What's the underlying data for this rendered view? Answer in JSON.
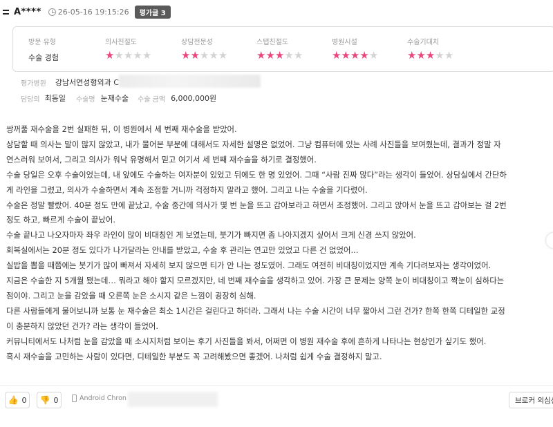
{
  "header": {
    "user_name": "A****",
    "timestamp": "26-05-16 19:15:26",
    "rating_badge": "평가글 3"
  },
  "ratings": {
    "visit_type": {
      "label": "방문 유형",
      "value": "수술 경험"
    },
    "items": [
      {
        "label": "의사친절도",
        "stars": 1,
        "max": 5
      },
      {
        "label": "상담전문성",
        "stars": 2,
        "max": 5
      },
      {
        "label": "스탭친절도",
        "stars": 3,
        "max": 5
      },
      {
        "label": "병원시설",
        "stars": 4,
        "max": 5
      },
      {
        "label": "수술기대치",
        "stars": 3,
        "max": 5
      }
    ],
    "star_on_color": "#e8467c",
    "star_off_color": "#d3d3d3"
  },
  "meta": {
    "hospital_label": "평가병원",
    "hospital_value": "강남서연성형외과 C",
    "doctor_label": "담당의",
    "doctor_value": "최동일",
    "surgery_label": "수술명",
    "surgery_value": "눈재수술",
    "price_label": "수술 금액",
    "price_value": "6,000,000원"
  },
  "review": {
    "lines": [
      "쌍꺼풀 재수술을 2번 실패한 뒤, 이 병원에서 세 번째 재수술을 받았어.",
      "상담할 때 의사는 말이 많지 않았고, 내가 물어본 부분에 대해서도 자세한 설명은 없었어. 그냥 컴퓨터에 있는 사례 사진들을 보여줬는데, 결과가 정말 자",
      "연스러워 보여서, 그리고 의사가 워낙 유명해서 믿고 여기서 세 번째 재수술을 하기로 결정했어.",
      "수술 당일은 오후 수술이었는데, 내 앞에도 수술하는 여자분이 있었고 뒤에도 한 명 있었어. 그때 “사람 진짜 많다”라는 생각이 들었어. 상담실에서 간단하",
      "게 라인을 그렸고, 의사가 수술하면서 계속 조정할 거니까 걱정하지 말라고 했어. 그리고 나는 수술을 기다렸어.",
      "수술은 정말 빨랐어. 40분 정도 만에 끝났고, 수술 중간에 의사가 몇 번 눈을 뜨고 감아보라고 하면서 조정했어. 그리고 앉아서 눈을 뜨고 감아보는 걸 2번",
      "정도 하고, 빠르게 수술이 끝났어.",
      "수술 끝나고 나오자마자 좌우 라인이 많이 비대칭인 게 보였는데, 붓기가 빠지면 좀 나아지겠지 싶어서 크게 신경 쓰지 않았어.",
      "회복실에서는 20분 정도 있다가 나가달라는 안내를 받았고, 수술 후 관리는 연고만 있었고 다른 건 없었어...",
      "실밥을 뽑을 때쯤에는 붓기가 많이 빠져서 자세히 보지 않으면 티가 안 나는 정도였어. 그래도 여전히 비대칭이었지만 계속 기다려보자는 생각이었어.",
      "지금은 수술한 지 5개월 됐는데… 뭐라고 해야 할지 모르겠지만, 네 번째 재수술을 생각하고 있어. 가장 큰 문제는 양쪽 눈이 비대칭이고 짝눈이 심하다는",
      "점이야. 그리고 눈을 감았을 때 오른쪽 눈은 소시지 같은 느낌이 굉장히 심해.",
      "다른 사람들에게 물어보니까 보통 눈 재수술은 최소 1시간은 걸린다고 하더라. 그래서 나는 수술 시간이 너무 짧아서 그런 건가? 한쪽 한쪽 디테일한 교정",
      "이 충분하지 않았던 건가? 라는 생각이 들었어.",
      "커뮤니티에서도 나처럼 눈을 감았을 때 소시지처럼 보이는 후기 사진들을 봐서, 어쩌면 이 병원 재수술 후에 흔하게 나타나는 현상인가 싶기도 했어.",
      "혹시 재수술을 고민하는 사람이 있다면, 디테일한 부분도 꼭 고려해봤으면 좋겠어. 나처럼 쉽게 수술 결정하지 말고."
    ]
  },
  "footer": {
    "like_count": "0",
    "dislike_count": "0",
    "device": "Android Chron",
    "broker_button": "브로커 의심신고"
  }
}
